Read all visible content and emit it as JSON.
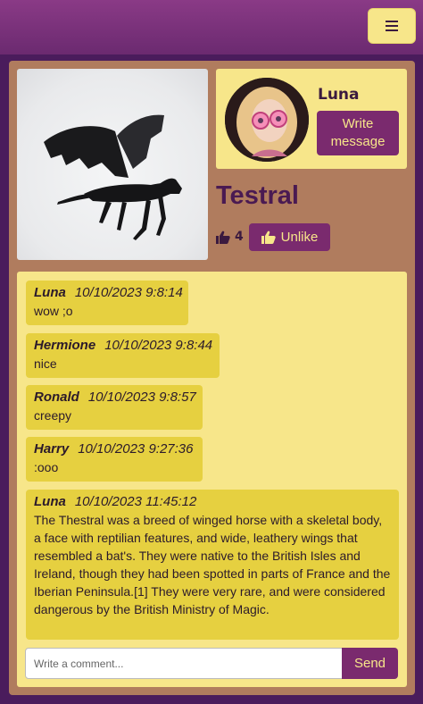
{
  "header": {
    "menu_icon": "hamburger-icon"
  },
  "post": {
    "image_alt": "black winged creature figure",
    "title": "Testral",
    "likes": "4",
    "unlike_label": "Unlike",
    "like_icon": "thumbs-up-icon"
  },
  "profile": {
    "name": "Luna",
    "write_message_line1": "Write",
    "write_message_line2": "message"
  },
  "comments": [
    {
      "author": "Luna",
      "date": "10/10/2023 9:8:14",
      "text": "wow ;o"
    },
    {
      "author": "Hermione",
      "date": "10/10/2023 9:8:44",
      "text": "nice"
    },
    {
      "author": "Ronald",
      "date": "10/10/2023 9:8:57",
      "text": "creepy"
    },
    {
      "author": "Harry",
      "date": "10/10/2023 9:27:36",
      "text": ":ooo"
    },
    {
      "author": "Luna",
      "date": "10/10/2023 11:45:12",
      "text": "The Thestral was a breed of winged horse with a skeletal body, a face with reptilian features, and wide, leathery wings that resembled a bat's. They were native to the British Isles and Ireland, though they had been spotted in parts of France and the Iberian Peninsula.[1] They were very rare, and were considered dangerous by the British Ministry of Magic."
    }
  ],
  "comment_form": {
    "placeholder": "Write a comment...",
    "send_label": "Send"
  },
  "colors": {
    "header": "#7e3380",
    "accent": "#7a2a6e",
    "panel": "#f7e68a",
    "comment_bubble": "#e6d040",
    "card": "#b07c5e"
  }
}
